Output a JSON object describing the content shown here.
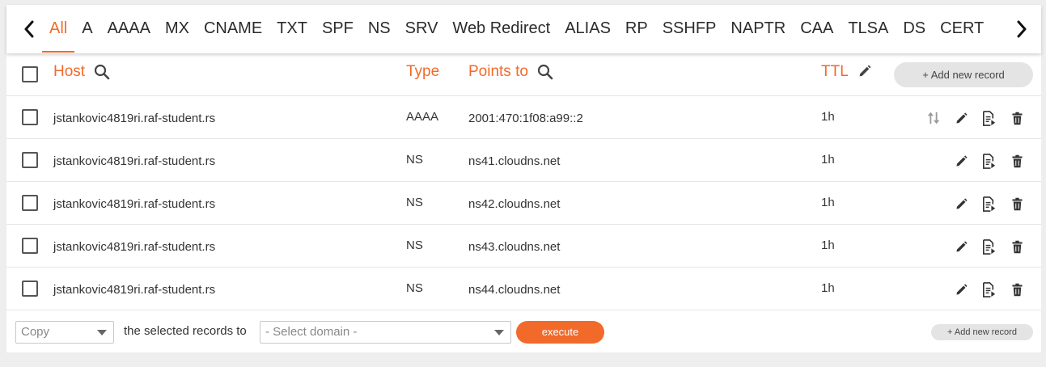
{
  "tabs": [
    "All",
    "A",
    "AAAA",
    "MX",
    "CNAME",
    "TXT",
    "SPF",
    "NS",
    "SRV",
    "Web Redirect",
    "ALIAS",
    "RP",
    "SSHFP",
    "NAPTR",
    "CAA",
    "TLSA",
    "DS",
    "CERT"
  ],
  "active_tab": "All",
  "header": {
    "host": "Host",
    "type": "Type",
    "points_to": "Points to",
    "ttl": "TTL",
    "add_new_record": "+ Add new record"
  },
  "records": [
    {
      "host": "jstankovic4819ri.raf-student.rs",
      "type": "AAAA",
      "points_to": "2001:470:1f08:a99::2",
      "ttl": "1h"
    },
    {
      "host": "jstankovic4819ri.raf-student.rs",
      "type": "NS",
      "points_to": "ns41.cloudns.net",
      "ttl": "1h"
    },
    {
      "host": "jstankovic4819ri.raf-student.rs",
      "type": "NS",
      "points_to": "ns42.cloudns.net",
      "ttl": "1h"
    },
    {
      "host": "jstankovic4819ri.raf-student.rs",
      "type": "NS",
      "points_to": "ns43.cloudns.net",
      "ttl": "1h"
    },
    {
      "host": "jstankovic4819ri.raf-student.rs",
      "type": "NS",
      "points_to": "ns44.cloudns.net",
      "ttl": "1h"
    }
  ],
  "footer": {
    "action_select": "Copy",
    "between_text": "the selected records to",
    "domain_select_placeholder": "- Select domain -",
    "execute_label": "execute",
    "add_new_record": "+ Add new record"
  },
  "colors": {
    "accent": "#f26a2a",
    "background": "#eeeeee",
    "card": "#ffffff"
  },
  "icons": {
    "prev": "chevron-left-icon",
    "next": "chevron-right-icon",
    "search": "search-icon",
    "edit": "pencil-icon",
    "sort": "sort-arrows-icon",
    "export": "document-export-icon",
    "delete": "trash-icon"
  }
}
